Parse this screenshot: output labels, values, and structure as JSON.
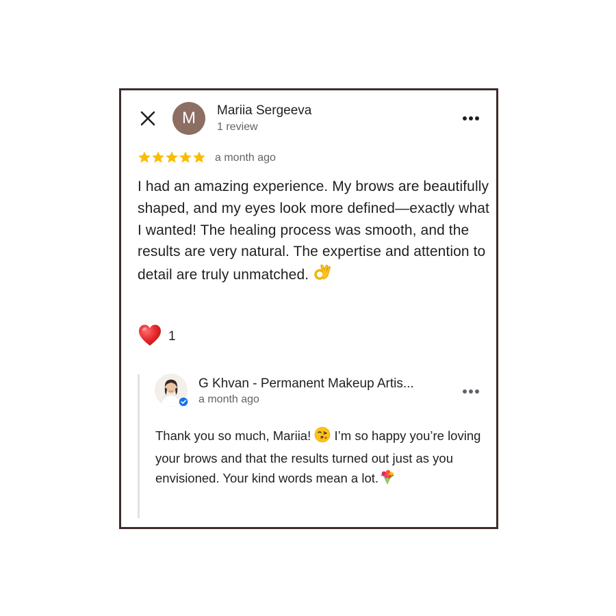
{
  "review": {
    "reviewer_initial": "M",
    "reviewer_name": "Mariia Sergeeva",
    "review_count": "1 review",
    "rating": 5,
    "max_rating": 5,
    "date": "a month ago",
    "text": "I had an amazing experience. My brows are beautifully shaped, and my eyes look more defined—exactly what I wanted! The healing process was smooth, and the results are very natural. The expertise and attention to detail are truly unmatched.",
    "text_emoji": "ok-hand-icon",
    "like_count": "1",
    "avatar_color": "#8d6e63",
    "star_color": "#fbbc04",
    "like_icon": "red-heart-icon"
  },
  "reply": {
    "owner_name": "G Khvan - Permanent Makeup Artis...",
    "date": "a month ago",
    "text_part1": "Thank you so much, Mariia!",
    "text_emoji1": "kissing-face-icon",
    "text_part2": "I’m so happy you’re loving your brows and that the results turned out just as you envisioned. Your kind words mean a lot.",
    "text_emoji2": "bouquet-icon",
    "verified_color": "#1a73e8"
  },
  "icons": {
    "close": "close-icon",
    "more": "more-options-icon",
    "verified": "verified-badge-icon"
  }
}
